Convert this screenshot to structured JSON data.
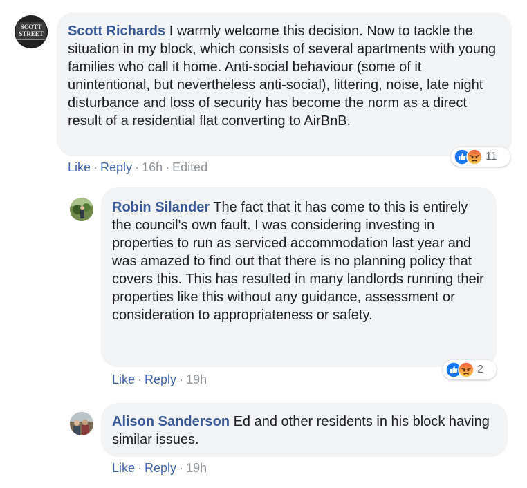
{
  "comments": [
    {
      "author": "Scott Richards",
      "text": "I warmly welcome this decision. Now to tackle the situation in my block, which consists of several apartments with young families who call it home. Anti-social behaviour (some of it unintentional, but nevertheless anti-social), littering, noise, late night disturbance and loss of security has become the norm as a direct result of a residential flat converting to AirBnB.",
      "avatar_text": [
        "SCOTT",
        "STREET"
      ],
      "like_label": "Like",
      "reply_label": "Reply",
      "time": "16h",
      "edited": "Edited",
      "reaction_count": "11",
      "reactions": [
        "like-icon",
        "angry-icon"
      ]
    },
    {
      "author": "Robin Silander",
      "text": "The fact that it has come to this is entirely the council's own fault. I was considering investing in properties to run as serviced accommodation last year and was amazed to find out that there is no planning policy that covers this. This has resulted in many landlords running their properties like this without any guidance, assessment or consideration to appropriateness or safety.",
      "like_label": "Like",
      "reply_label": "Reply",
      "time": "19h",
      "reaction_count": "2",
      "reactions": [
        "like-icon",
        "angry-icon"
      ]
    },
    {
      "author": "Alison Sanderson",
      "text": "Ed and other residents in his block having similar issues.",
      "like_label": "Like",
      "reply_label": "Reply",
      "time": "19h"
    }
  ],
  "separator": "·",
  "colors": {
    "link": "#385898",
    "action_link": "#4267b2",
    "bubble_bg": "#f2f3f5",
    "like_blue": "#1877f2",
    "angry_top": "#f05a3c",
    "angry_bottom": "#fcd24e"
  }
}
